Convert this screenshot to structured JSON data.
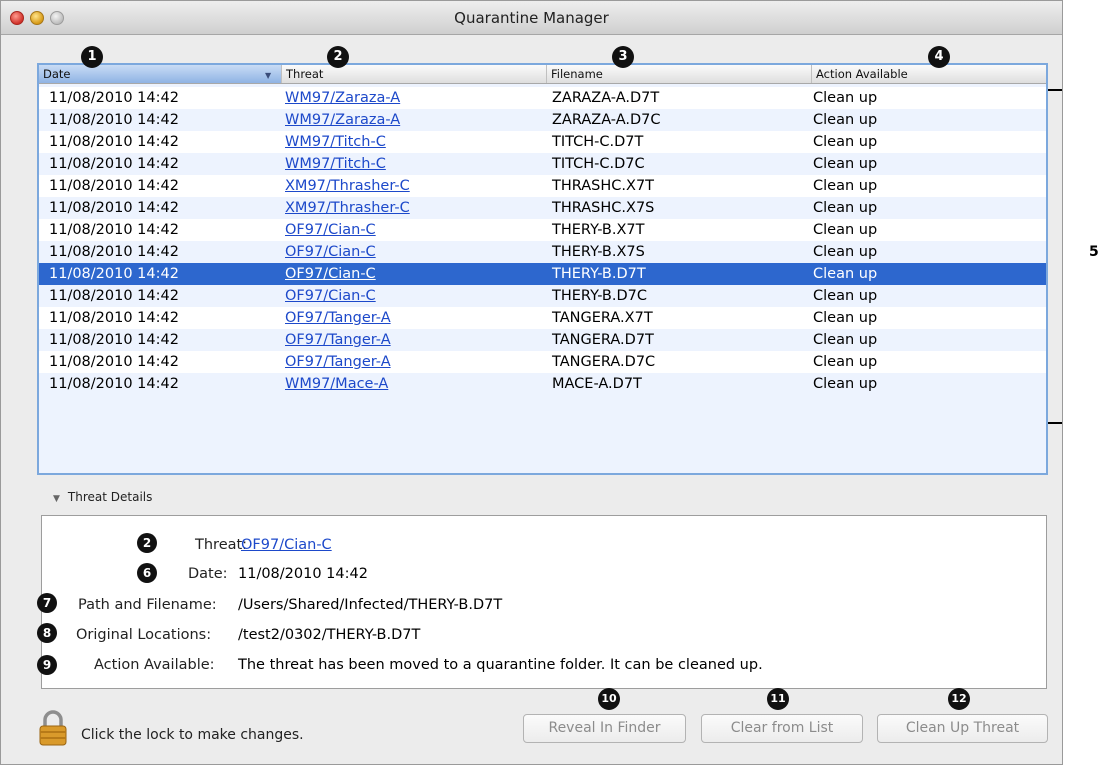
{
  "window": {
    "title": "Quarantine Manager"
  },
  "table": {
    "columns": [
      "Date",
      "Threat",
      "Filename",
      "Action Available"
    ],
    "rows": [
      [
        "11/08/2010 14:42",
        "WM97/Zaraza-A",
        "ZARAZA-A.D7T",
        "Clean up"
      ],
      [
        "11/08/2010 14:42",
        "WM97/Zaraza-A",
        "ZARAZA-A.D7C",
        "Clean up"
      ],
      [
        "11/08/2010 14:42",
        "WM97/Titch-C",
        "TITCH-C.D7T",
        "Clean up"
      ],
      [
        "11/08/2010 14:42",
        "WM97/Titch-C",
        "TITCH-C.D7C",
        "Clean up"
      ],
      [
        "11/08/2010 14:42",
        "XM97/Thrasher-C",
        "THRASHC.X7T",
        "Clean up"
      ],
      [
        "11/08/2010 14:42",
        "XM97/Thrasher-C",
        "THRASHC.X7S",
        "Clean up"
      ],
      [
        "11/08/2010 14:42",
        "OF97/Cian-C",
        "THERY-B.X7T",
        "Clean up"
      ],
      [
        "11/08/2010 14:42",
        "OF97/Cian-C",
        "THERY-B.X7S",
        "Clean up"
      ],
      [
        "11/08/2010 14:42",
        "OF97/Cian-C",
        "THERY-B.D7T",
        "Clean up"
      ],
      [
        "11/08/2010 14:42",
        "OF97/Cian-C",
        "THERY-B.D7C",
        "Clean up"
      ],
      [
        "11/08/2010 14:42",
        "OF97/Tanger-A",
        "TANGERA.X7T",
        "Clean up"
      ],
      [
        "11/08/2010 14:42",
        "OF97/Tanger-A",
        "TANGERA.D7T",
        "Clean up"
      ],
      [
        "11/08/2010 14:42",
        "OF97/Tanger-A",
        "TANGERA.D7C",
        "Clean up"
      ],
      [
        "11/08/2010 14:42",
        "WM97/Mace-A",
        "MACE-A.D7T",
        "Clean up"
      ]
    ],
    "selected_row": 8
  },
  "callouts": {
    "date_col": "1",
    "threat_col": "2",
    "filename_col": "3",
    "action_col": "4",
    "rows_group": "5",
    "detail_threat": "2",
    "detail_date": "6",
    "detail_path": "7",
    "detail_original": "8",
    "detail_action": "9",
    "reveal_btn": "10",
    "clear_btn": "11",
    "cleanup_btn": "12"
  },
  "details": {
    "section_title": "Threat Details",
    "threat_label": "Threat:",
    "threat_value": "OF97/Cian-C",
    "date_label": "Date:",
    "date_value": "11/08/2010 14:42",
    "path_label": "Path and Filename:",
    "path_value": "/Users/Shared/Infected/THERY-B.D7T",
    "original_label": "Original Locations:",
    "original_value": "/test2/0302/THERY-B.D7T",
    "action_label": "Action Available:",
    "action_value": "The threat has been moved to a quarantine folder. It can be cleaned up."
  },
  "footer": {
    "lock_text": "Click the lock to make changes.",
    "reveal_label": "Reveal In Finder",
    "clear_label": "Clear from List",
    "cleanup_label": "Clean Up Threat"
  },
  "icons": {
    "lock": "lock-icon",
    "disclosure": "disclosure-triangle-icon",
    "sort": "sort-descending-icon"
  },
  "colors": {
    "selection": "#2d67ce",
    "link": "#1d49ca",
    "alt_row": "#edf3fe",
    "frame_focus": "#7ca8dd"
  }
}
